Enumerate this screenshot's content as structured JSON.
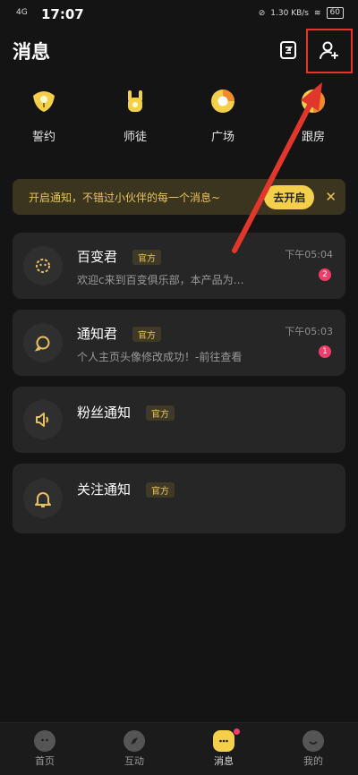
{
  "status_bar": {
    "network": "4G",
    "time": "17:07",
    "speed": "1.30 KB/s",
    "battery": "60"
  },
  "header": {
    "title": "消息"
  },
  "quick_actions": [
    {
      "label": "誓约",
      "icon": "pledge-icon"
    },
    {
      "label": "师徒",
      "icon": "mentor-hand-icon"
    },
    {
      "label": "广场",
      "icon": "plaza-icon"
    },
    {
      "label": "跟房",
      "icon": "follow-room-icon"
    }
  ],
  "notify_banner": {
    "text": "开启通知，不错过小伙伴的每一个消息~",
    "button": "去开启"
  },
  "conversations": [
    {
      "name": "百变君",
      "badge": "官方",
      "message": "欢迎c来到百变俱乐部，本产品为…",
      "time": "下午05:04",
      "unread": "2",
      "icon": "gear-mascot-icon"
    },
    {
      "name": "通知君",
      "badge": "官方",
      "message": "个人主页头像修改成功！-前往查看",
      "time": "下午05:03",
      "unread": "1",
      "icon": "chat-bubble-icon"
    },
    {
      "name": "粉丝通知",
      "badge": "官方",
      "icon": "speaker-icon"
    },
    {
      "name": "关注通知",
      "badge": "官方",
      "icon": "bell-icon"
    }
  ],
  "tabbar": [
    {
      "label": "首页",
      "icon": "home-icon"
    },
    {
      "label": "互动",
      "icon": "compass-icon"
    },
    {
      "label": "消息",
      "icon": "message-icon"
    },
    {
      "label": "我的",
      "icon": "profile-icon"
    }
  ],
  "colors": {
    "accent": "#f4d04a",
    "badge_red": "#f23c6a",
    "annotation_red": "#e0362b"
  }
}
